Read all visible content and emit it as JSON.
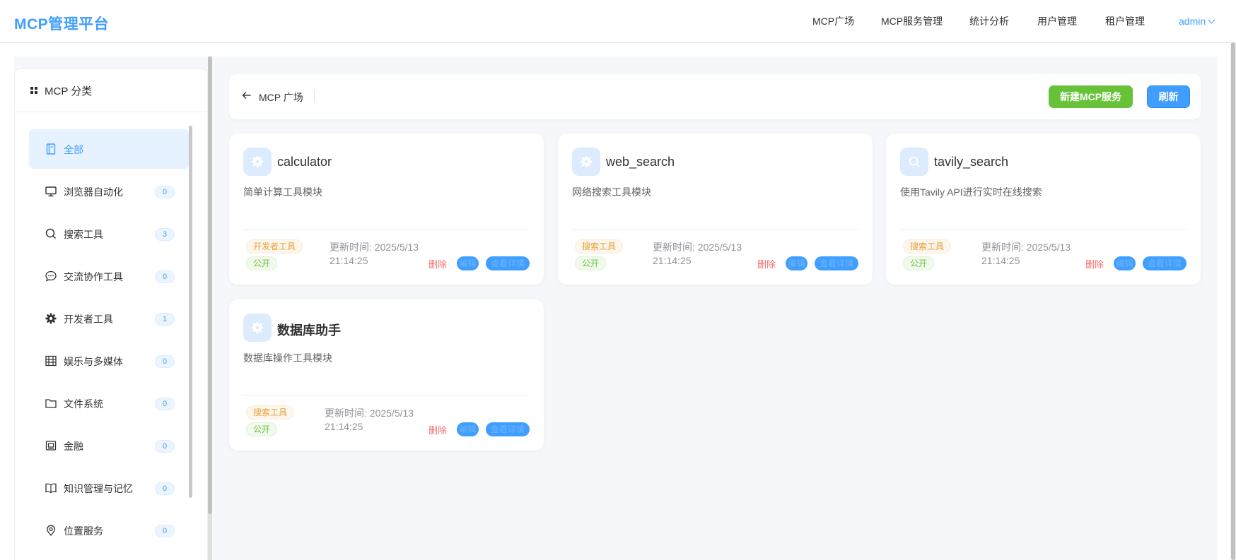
{
  "header": {
    "brand": "MCP管理平台",
    "nav": [
      {
        "label": "MCP广场"
      },
      {
        "label": "MCP服务管理"
      },
      {
        "label": "统计分析"
      },
      {
        "label": "用户管理"
      },
      {
        "label": "租户管理"
      }
    ],
    "user": "admin"
  },
  "sidebar": {
    "title": "MCP 分类",
    "items": [
      {
        "label": "全部",
        "icon": "book-icon",
        "count": ""
      },
      {
        "label": "浏览器自动化",
        "icon": "monitor-icon",
        "count": "0"
      },
      {
        "label": "搜索工具",
        "icon": "search-icon",
        "count": "3"
      },
      {
        "label": "交流协作工具",
        "icon": "chat-bubble-icon",
        "count": "0"
      },
      {
        "label": "开发者工具",
        "icon": "gear-icon",
        "count": "1"
      },
      {
        "label": "娱乐与多媒体",
        "icon": "film-grid-icon",
        "count": "0"
      },
      {
        "label": "文件系统",
        "icon": "folder-icon",
        "count": "0"
      },
      {
        "label": "金融",
        "icon": "wallet-icon",
        "count": "0"
      },
      {
        "label": "知识管理与记忆",
        "icon": "open-book-icon",
        "count": "0"
      },
      {
        "label": "位置服务",
        "icon": "location-pin-icon",
        "count": "0"
      }
    ]
  },
  "toolbar": {
    "breadcrumb": "MCP 广场",
    "new_button": "新建MCP服务",
    "refresh_button": "刷新"
  },
  "cards": [
    {
      "name": "calculator",
      "icon": "gear-icon",
      "desc": "简单计算工具模块",
      "category": "开发者工具",
      "visibility": "公开",
      "time_line1": "更新时间: 2025/5/13",
      "time_line2": "21:14:25",
      "delete": "删除",
      "edit": "编辑",
      "detail": "查看详情"
    },
    {
      "name": "web_search",
      "icon": "gear-icon",
      "desc": "网络搜索工具模块",
      "category": "搜索工具",
      "visibility": "公开",
      "time_line1": "更新时间: 2025/5/13",
      "time_line2": "21:14:25",
      "delete": "删除",
      "edit": "编辑",
      "detail": "查看详情"
    },
    {
      "name": "tavily_search",
      "icon": "search-icon",
      "desc": "使用Tavily API进行实时在线搜索",
      "category": "搜索工具",
      "visibility": "公开",
      "time_line1": "更新时间: 2025/5/13",
      "time_line2": "21:14:25",
      "delete": "删除",
      "edit": "编辑",
      "detail": "查看详情"
    },
    {
      "name": "数据库助手",
      "icon": "gear-icon",
      "desc": "数据库操作工具模块",
      "category": "搜索工具",
      "visibility": "公开",
      "time_line1": "更新时间: 2025/5/13",
      "time_line2": "21:14:25",
      "delete": "删除",
      "edit": "编辑",
      "detail": "查看详情"
    }
  ],
  "colors": {
    "accent": "#409eff",
    "success": "#67c23a",
    "warning": "#e6a23c",
    "danger": "#f56c6c"
  }
}
